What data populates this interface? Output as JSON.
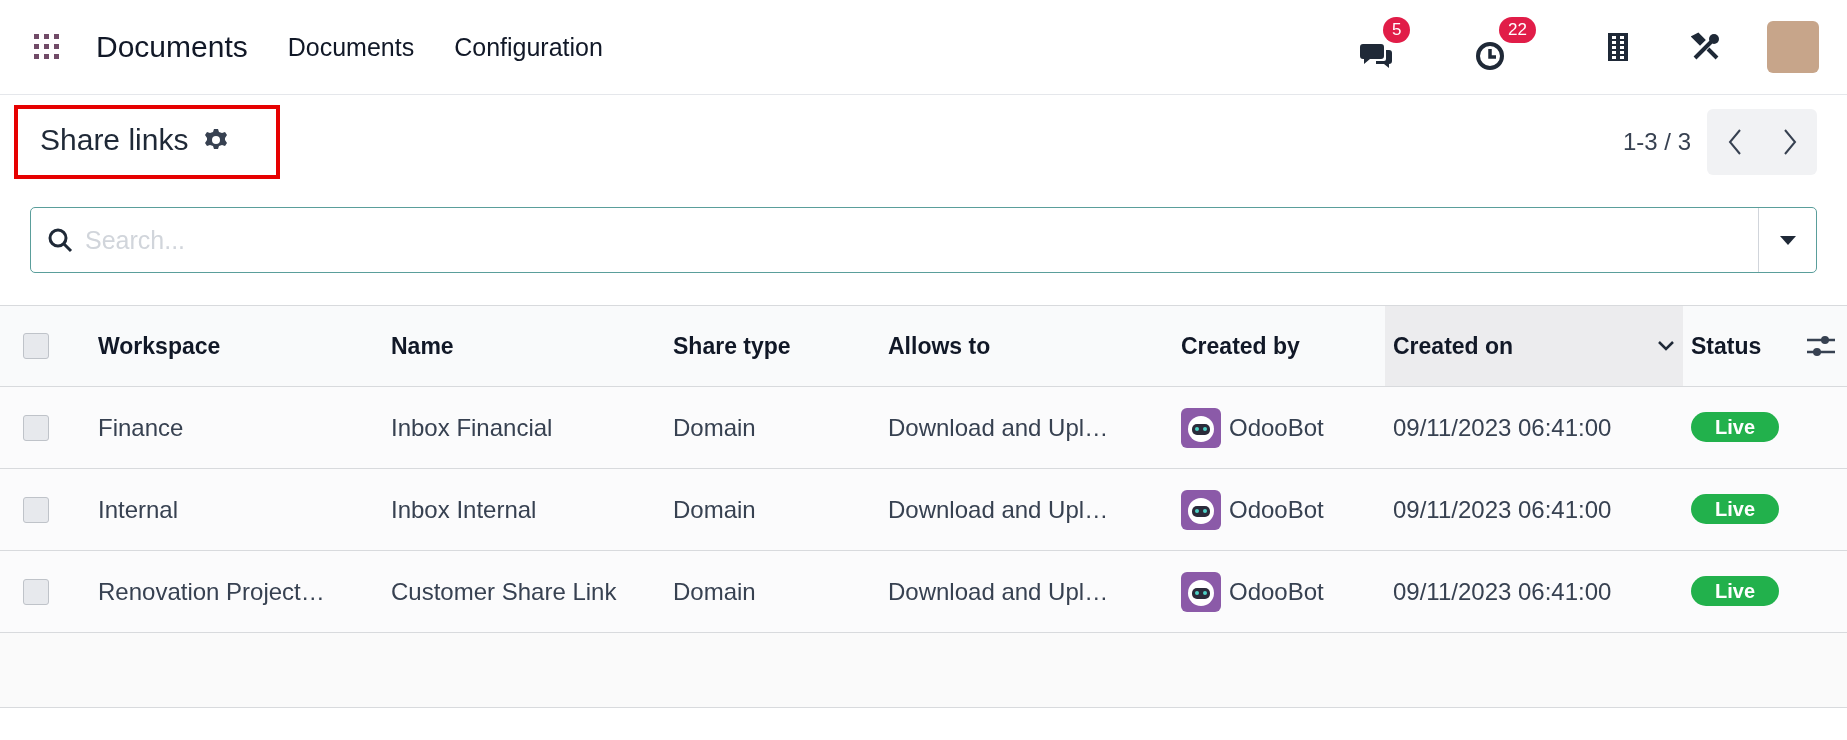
{
  "navbar": {
    "app_name": "Documents",
    "menu": [
      "Documents",
      "Configuration"
    ],
    "messages_count": "5",
    "activities_count": "22"
  },
  "control_panel": {
    "title": "Share links",
    "highlighted": true,
    "pager": "1-3 / 3",
    "search": {
      "placeholder": "Search..."
    }
  },
  "table": {
    "header_checked": false,
    "columns": [
      {
        "label": "Workspace",
        "sorted": false
      },
      {
        "label": "Name",
        "sorted": false
      },
      {
        "label": "Share type",
        "sorted": false
      },
      {
        "label": "Allows to",
        "sorted": false
      },
      {
        "label": "Created by",
        "sorted": false
      },
      {
        "label": "Created on",
        "sorted": true
      },
      {
        "label": "Status",
        "sorted": false
      }
    ],
    "rows": [
      {
        "checked": false,
        "workspace": "Finance",
        "name": "Inbox Financial",
        "share_type": "Domain",
        "allows_to": "Download and Upl…",
        "created_by": "OdooBot",
        "created_on": "09/11/2023 06:41:00",
        "status": "Live"
      },
      {
        "checked": false,
        "workspace": "Internal",
        "name": "Inbox Internal",
        "share_type": "Domain",
        "allows_to": "Download and Upl…",
        "created_by": "OdooBot",
        "created_on": "09/11/2023 06:41:00",
        "status": "Live"
      },
      {
        "checked": false,
        "workspace": "Renovation Project…",
        "name": "Customer Share Link",
        "share_type": "Domain",
        "allows_to": "Download and Upl…",
        "created_by": "OdooBot",
        "created_on": "09/11/2023 06:41:00",
        "status": "Live"
      }
    ]
  }
}
